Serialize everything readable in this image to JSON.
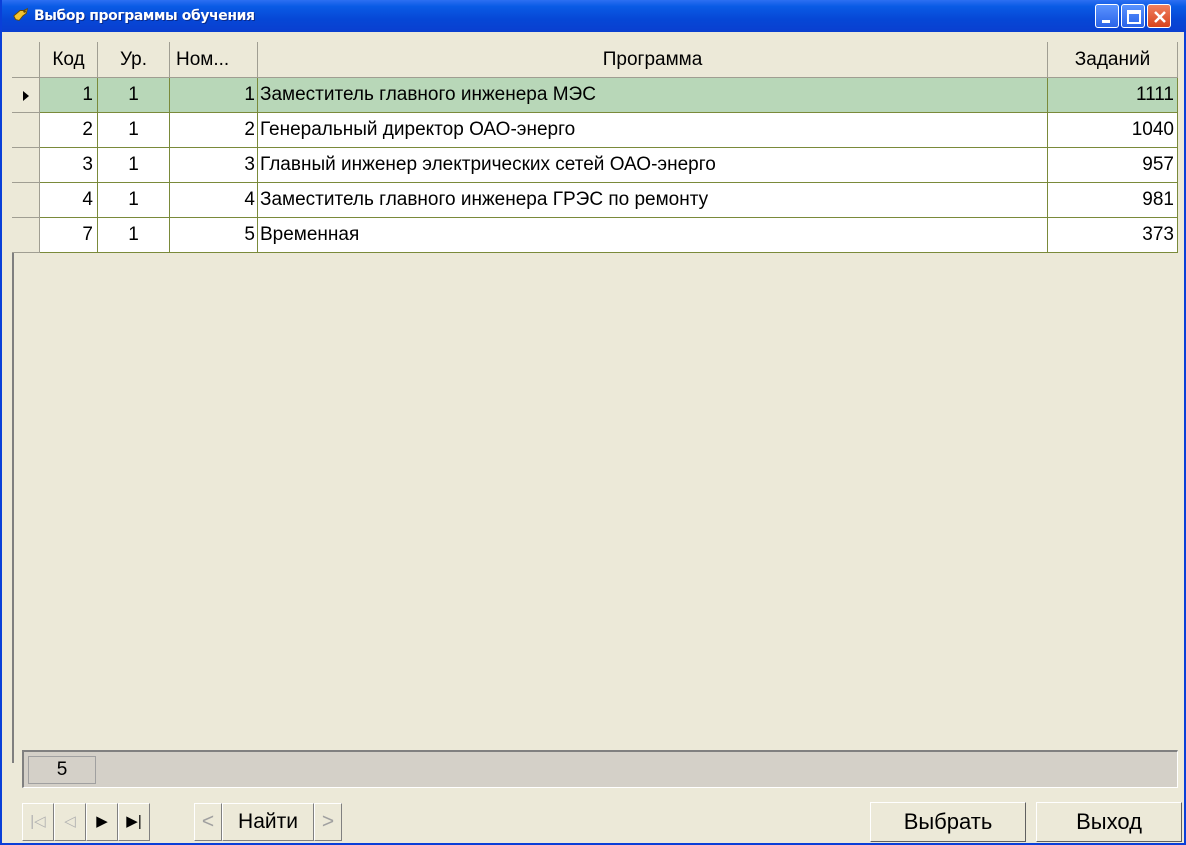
{
  "window": {
    "title": "Выбор программы обучения"
  },
  "table": {
    "columns": [
      "Код",
      "Ур.",
      "Ном...",
      "Программа",
      "Заданий"
    ],
    "rows": [
      {
        "kod": "1",
        "ur": "1",
        "nom": "1",
        "prog": "Заместитель главного инженера  МЭС",
        "zad": "1111"
      },
      {
        "kod": "2",
        "ur": "1",
        "nom": "2",
        "prog": "Генеральный директор ОАО-энерго",
        "zad": "1040"
      },
      {
        "kod": "3",
        "ur": "1",
        "nom": "3",
        "prog": "Главный инженер электрических сетей ОАО-энерго",
        "zad": "957"
      },
      {
        "kod": "4",
        "ur": "1",
        "nom": "4",
        "prog": "Заместитель главного инженера ГРЭС по ремонту",
        "zad": "981"
      },
      {
        "kod": "7",
        "ur": "1",
        "nom": "5",
        "prog": "Временная",
        "zad": "373"
      }
    ],
    "selected_row": 0
  },
  "footer": {
    "record_count": "5"
  },
  "navigator": {
    "first_icon": "|◁",
    "prev_icon": "◁",
    "next_icon": "▶",
    "last_icon": "▶|",
    "find_prev": "<",
    "find_label": "Найти",
    "find_next": ">"
  },
  "buttons": {
    "select_label": "Выбрать",
    "exit_label": "Выход"
  },
  "colors": {
    "titlebar": "#0a5be5",
    "selected_row": "#b8d7b8",
    "face": "#ece9d8"
  }
}
